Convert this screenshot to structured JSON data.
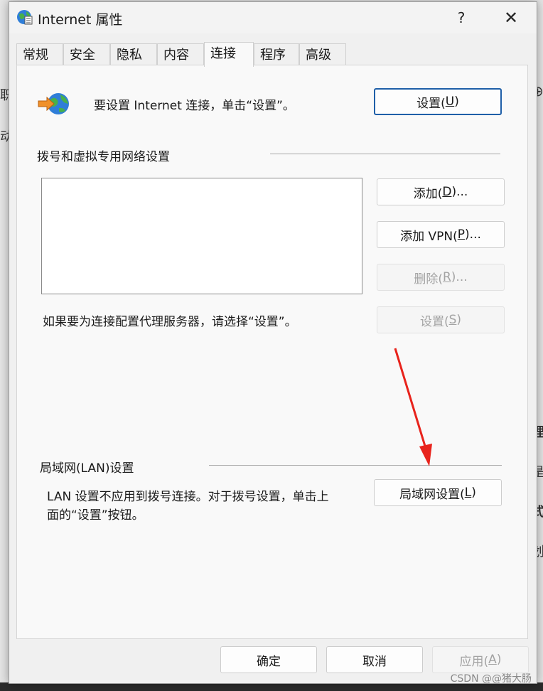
{
  "window": {
    "title": "Internet 属性",
    "help": "?",
    "close": "✕"
  },
  "tabs": [
    "常规",
    "安全",
    "隐私",
    "内容",
    "连接",
    "程序",
    "高级"
  ],
  "active_tab": 4,
  "setup": {
    "text": "要设置 Internet 连接，单击“设置”。",
    "button": {
      "pre": "设置(",
      "key": "U",
      "post": ")"
    }
  },
  "vpn": {
    "heading": "拨号和虚拟专用网络设置",
    "add": {
      "pre": "添加(",
      "key": "D",
      "post": ")..."
    },
    "add_vpn": {
      "pre": "添加 VPN(",
      "key": "P",
      "post": ")..."
    },
    "remove": {
      "pre": "删除(",
      "key": "R",
      "post": ")..."
    },
    "proxy_text": "如果要为连接配置代理服务器，请选择“设置”。",
    "settings": {
      "pre": "设置(",
      "key": "S",
      "post": ")"
    }
  },
  "lan": {
    "heading": "局域网(LAN)设置",
    "text_line1": "LAN 设置不应用到拨号连接。对于拨号设置，单击上",
    "text_line2": "面的“设置”按钮。",
    "button": {
      "pre": "局域网设置(",
      "key": "L",
      "post": ")"
    }
  },
  "footer": {
    "ok": "确定",
    "cancel": "取消",
    "apply": {
      "pre": "应用(",
      "key": "A",
      "post": ")"
    }
  },
  "watermark": "CSDN @@猪大肠",
  "colors": {
    "accent": "#1f5fa8",
    "arrow": "#e8231c"
  }
}
